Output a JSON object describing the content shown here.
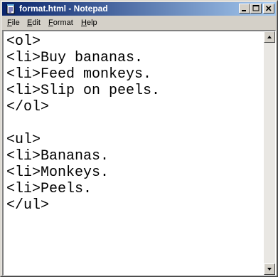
{
  "window": {
    "title": "format.html - Notepad"
  },
  "menu": [
    {
      "mnemonic": "F",
      "rest": "ile"
    },
    {
      "mnemonic": "E",
      "rest": "dit"
    },
    {
      "mnemonic": "F",
      "rest": "ormat"
    },
    {
      "mnemonic": "H",
      "rest": "elp"
    }
  ],
  "editor": {
    "lines": [
      "<ol>",
      "<li>Buy bananas.",
      "<li>Feed monkeys.",
      "<li>Slip on peels.",
      "</ol>",
      "",
      "<ul>",
      "<li>Bananas.",
      "<li>Monkeys.",
      "<li>Peels.",
      "</ul>"
    ]
  },
  "icons": {
    "app": "notepad-icon",
    "minimize": "minimize-icon",
    "maximize": "maximize-icon",
    "close": "close-icon",
    "scroll_up": "scroll-up-arrow-icon",
    "scroll_down": "scroll-down-arrow-icon"
  },
  "colors": {
    "titlebar_start": "#0a246a",
    "titlebar_end": "#a6caf0",
    "chrome": "#d4d0c8",
    "editor_bg": "#ffffff"
  }
}
